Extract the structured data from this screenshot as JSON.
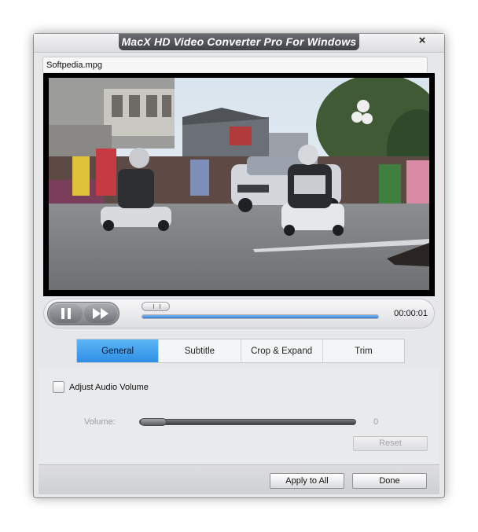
{
  "window": {
    "title": "MacX HD Video Converter Pro For Windows",
    "close_label": "×"
  },
  "file": {
    "tab_label": "Softpedia.mpg"
  },
  "player": {
    "time": "00:00:01",
    "progress": 0.0,
    "pause_icon": "pause-icon",
    "forward_icon": "fast-forward-icon"
  },
  "tabs": [
    {
      "label": "General",
      "active": true
    },
    {
      "label": "Subtitle",
      "active": false
    },
    {
      "label": "Crop & Expand",
      "active": false
    },
    {
      "label": "Trim",
      "active": false
    }
  ],
  "general": {
    "adjust_audio_label": "Adjust Audio Volume",
    "adjust_audio_checked": false,
    "volume_label": "Volume:",
    "volume_value": "0",
    "reset_label": "Reset"
  },
  "footer": {
    "apply_label": "Apply to All",
    "done_label": "Done"
  },
  "colors": {
    "accent_tab": "#3d9cef",
    "progress_fill": "#2f7ad6"
  }
}
